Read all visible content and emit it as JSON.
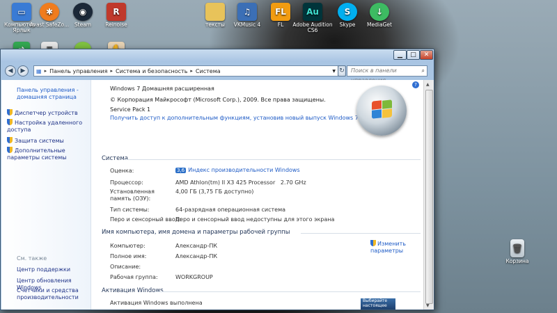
{
  "desktop": {
    "icons": [
      {
        "label": "Компьютер - Ярлык",
        "icon": "computer-icon",
        "color": "#3a7bd5"
      },
      {
        "label": "Avast SafeZo...",
        "icon": "avast-icon",
        "color": "#f07c1e"
      },
      {
        "label": "Steam",
        "icon": "steam-icon",
        "color": "#1b2838"
      },
      {
        "label": "Reinoise",
        "icon": "reinoise-icon",
        "color": "#c0392b"
      },
      {
        "label": "тексты",
        "icon": "folder-icon",
        "color": "#e8c35a"
      },
      {
        "label": "VKMusic 4",
        "icon": "vkmusic-icon",
        "color": "#3b6fb6"
      },
      {
        "label": "FL",
        "icon": "fl-studio-icon",
        "color": "#f29c11"
      },
      {
        "label": "Adobe Audition CS6",
        "icon": "audition-icon",
        "color": "#00343a"
      },
      {
        "label": "Skype",
        "icon": "skype-icon",
        "color": "#00aff0"
      },
      {
        "label": "MediaGet",
        "icon": "mediaget-icon",
        "color": "#3dbb62"
      },
      {
        "label": "",
        "icon": "green-app-icon",
        "color": "#33a852"
      },
      {
        "label": "",
        "icon": "document-icon",
        "color": "#e6e6e6"
      },
      {
        "label": "",
        "icon": "wine-icon",
        "color": "#7fc241"
      },
      {
        "label": "",
        "icon": "hand-icon",
        "color": "#e7d2b3"
      }
    ],
    "recycle_bin": "Корзина"
  },
  "window": {
    "breadcrumb": [
      "Панель управления",
      "Система и безопасность",
      "Система"
    ],
    "search_placeholder": "Поиск в панели управления",
    "left_pane": {
      "home": "Панель управления - домашняя страница",
      "links": [
        {
          "label": "Диспетчер устройств",
          "icon": "shield-icon"
        },
        {
          "label": "Настройка удаленного доступа",
          "icon": "shield-icon"
        },
        {
          "label": "Защита системы",
          "icon": "shield-icon"
        },
        {
          "label": "Дополнительные параметры системы",
          "icon": "shield-icon"
        }
      ],
      "see_also": "См. также",
      "see_also_links": [
        "Центр поддержки",
        "Центр обновления Windows",
        "Счетчики и средства производительности"
      ]
    },
    "edition": {
      "name": "Windows 7 Домашняя расширенная",
      "copyright": "© Корпорация Майкрософт (Microsoft Corp.), 2009. Все права защищены.",
      "service_pack": "Service Pack 1",
      "upgrade_link": "Получить доступ к дополнительным функциям, установив новый выпуск Windows 7"
    },
    "system": {
      "heading": "Система",
      "rating_label": "Оценка:",
      "rating_badge": "3,6",
      "rating_link": "Индекс производительности Windows",
      "processor_label": "Процессор:",
      "processor_value": "AMD Athlon(tm) II X3 425 Processor   2.70 GHz",
      "memory_label": "Установленная память (ОЗУ):",
      "memory_value": "4,00 ГБ (3,75 ГБ доступно)",
      "type_label": "Тип системы:",
      "type_value": "64-разрядная операционная система",
      "pen_label": "Перо и сенсорный ввод:",
      "pen_value": "Перо и сенсорный ввод недоступны для этого экрана"
    },
    "computer_name": {
      "heading": "Имя компьютера, имя домена и параметры рабочей группы",
      "computer_label": "Компьютер:",
      "computer_value": "Александр-ПК",
      "fullname_label": "Полное имя:",
      "fullname_value": "Александр-ПК",
      "description_label": "Описание:",
      "description_value": "",
      "workgroup_label": "Рабочая группа:",
      "workgroup_value": "WORKGROUP",
      "change_link": "Изменить параметры"
    },
    "activation": {
      "heading": "Активация Windows",
      "status": "Активация Windows выполнена",
      "genuine_text": "Выбирайте настоящее"
    }
  }
}
